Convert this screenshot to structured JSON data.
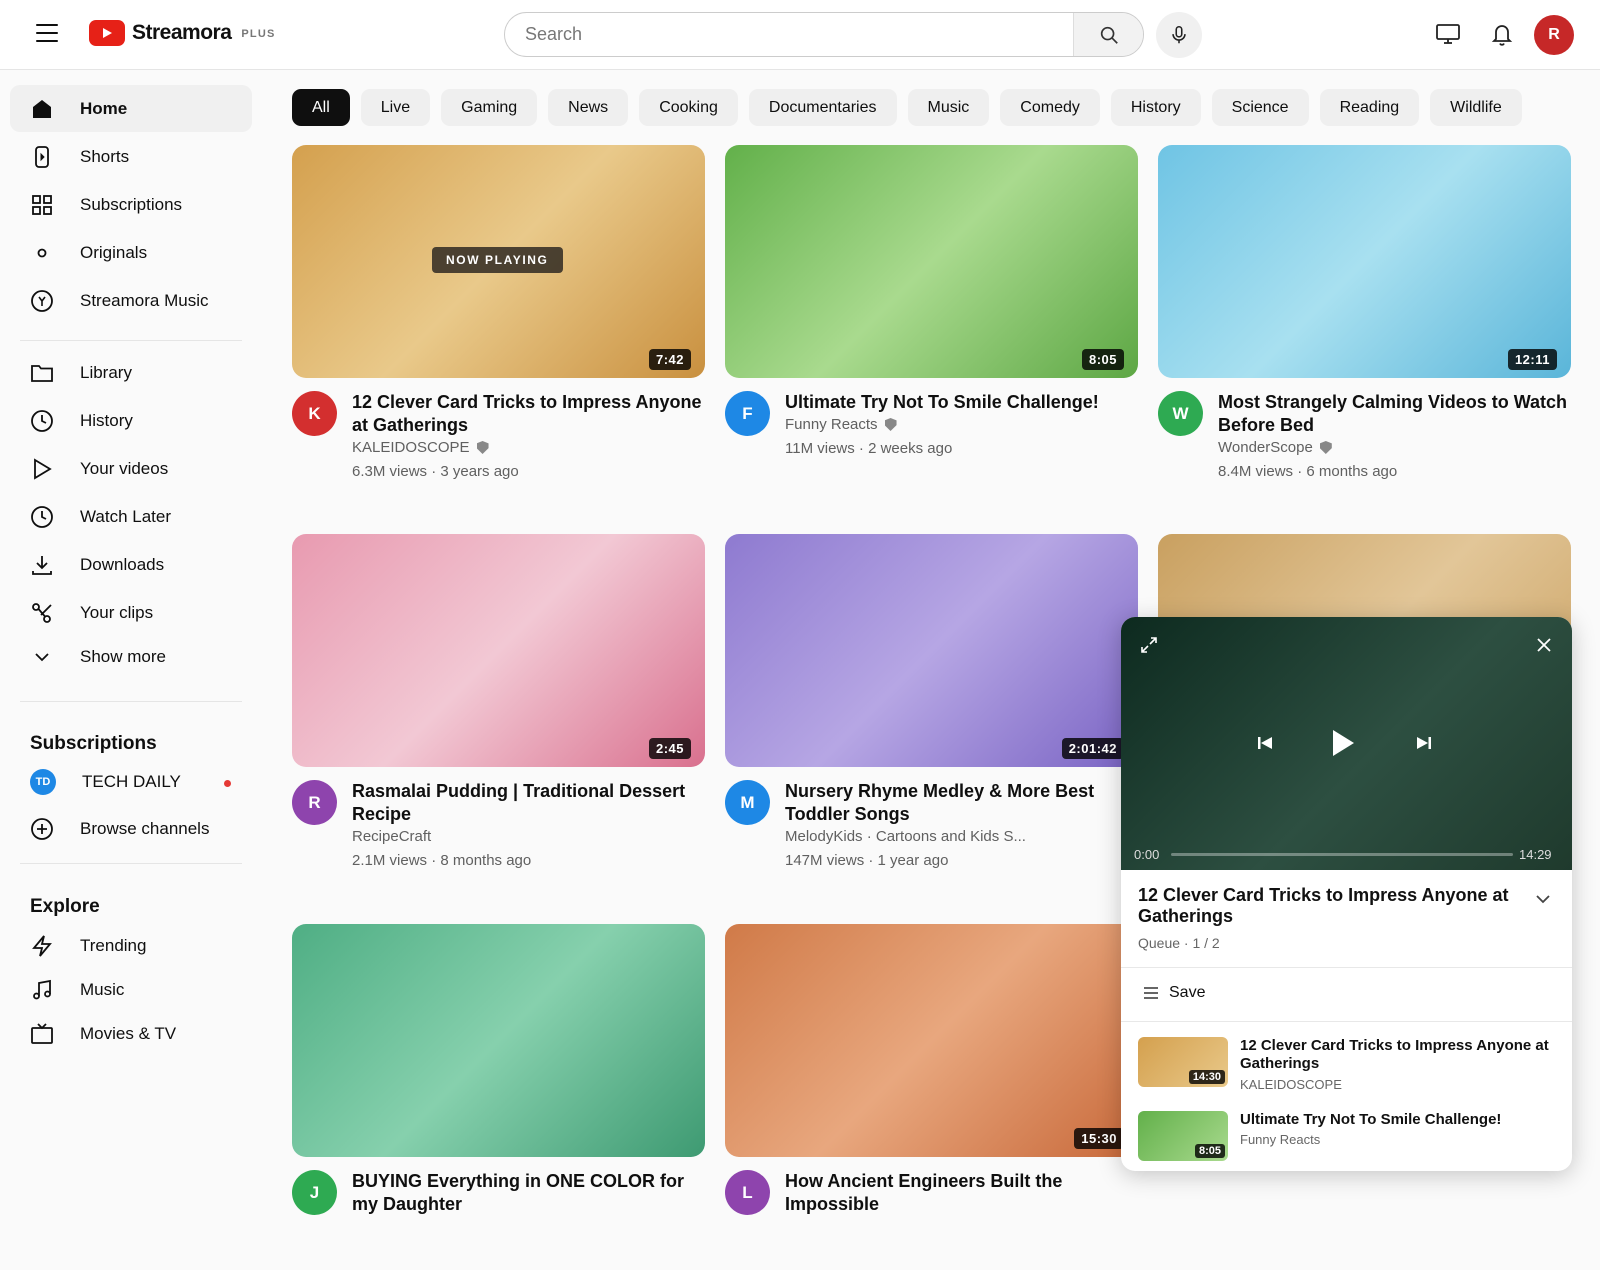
{
  "app": {
    "name": "Streamora",
    "badge": "PLUS"
  },
  "search": {
    "placeholder": "Search"
  },
  "user": {
    "initial": "R"
  },
  "sidebar": {
    "main": [
      {
        "label": "Home",
        "icon": "home-icon"
      },
      {
        "label": "Shorts",
        "icon": "shorts-icon"
      },
      {
        "label": "Subscriptions",
        "icon": "grid-icon"
      },
      {
        "label": "Originals",
        "icon": "circle-icon"
      },
      {
        "label": "Streamora Music",
        "icon": "music-circle-icon"
      }
    ],
    "library": [
      {
        "label": "Library",
        "icon": "folder-icon"
      },
      {
        "label": "History",
        "icon": "clock-icon"
      },
      {
        "label": "Your videos",
        "icon": "play-outline-icon"
      },
      {
        "label": "Watch Later",
        "icon": "clock-icon"
      },
      {
        "label": "Downloads",
        "icon": "download-icon"
      },
      {
        "label": "Your clips",
        "icon": "scissors-icon"
      },
      {
        "label": "Show more",
        "icon": "chevron-down-icon"
      }
    ],
    "subscriptions_heading": "Subscriptions",
    "subscriptions": [
      {
        "label": "TECH DAILY",
        "initials": "TD",
        "color": "#1e88e5",
        "new": true
      },
      {
        "label": "Browse channels",
        "icon": "plus-circle-icon"
      }
    ],
    "explore_heading": "Explore",
    "explore": [
      {
        "label": "Trending",
        "icon": "bolt-icon"
      },
      {
        "label": "Music",
        "icon": "music-note-icon"
      },
      {
        "label": "Movies & TV",
        "icon": "tv-icon"
      }
    ]
  },
  "chips": [
    "All",
    "Live",
    "Gaming",
    "News",
    "Cooking",
    "Documentaries",
    "Music",
    "Comedy",
    "History",
    "Science",
    "Reading",
    "Wildlife"
  ],
  "videos": [
    {
      "title": "12 Clever Card Tricks to Impress Anyone at Gatherings",
      "channel": "KALEIDOSCOPE",
      "verified": true,
      "views": "6.3M views · 3 years ago",
      "duration": "7:42",
      "overlay": "NOW PLAYING",
      "avatar": "K",
      "avatar_color": "#d32f2f",
      "colors": [
        "#d4a04e",
        "#e9c98a",
        "#c9903f"
      ]
    },
    {
      "title": "Ultimate Try Not To Smile Challenge!",
      "channel": "Funny Reacts",
      "verified": true,
      "views": "11M views · 2 weeks ago",
      "duration": "8:05",
      "avatar": "F",
      "avatar_color": "#1e88e5",
      "colors": [
        "#62b04a",
        "#a9da8e",
        "#5da744"
      ]
    },
    {
      "title": "Most Strangely Calming Videos to Watch Before Bed",
      "channel": "WonderScope",
      "verified": true,
      "views": "8.4M views · 6 months ago",
      "duration": "12:11",
      "avatar": "W",
      "avatar_color": "#2eaa52",
      "colors": [
        "#6fc4e4",
        "#a8e0f0",
        "#5ab5d9"
      ]
    },
    {
      "title": "Rasmalai Pudding | Traditional Dessert Recipe",
      "channel": "RecipeCraft",
      "verified": false,
      "views": "2.1M views · 8 months ago",
      "duration": "2:45",
      "avatar": "R",
      "avatar_color": "#8e44ad",
      "colors": [
        "#e89ab0",
        "#f2c8d4",
        "#d9708e"
      ]
    },
    {
      "title": "Nursery Rhyme Medley & More Best Toddler Songs",
      "channel": "MelodyKids · Cartoons and Kids S...",
      "verified": false,
      "views": "147M views · 1 year ago",
      "duration": "2:01:42",
      "avatar": "M",
      "avatar_color": "#1e88e5",
      "colors": [
        "#8e7ad0",
        "#b6a6e4",
        "#7a64c4"
      ]
    },
    {
      "title": "",
      "channel": "",
      "verified": false,
      "views": "",
      "duration": "",
      "avatar": "",
      "avatar_color": "#999",
      "colors": [
        "#c9a060",
        "#e2c698",
        "#c9a060"
      ]
    },
    {
      "title": "BUYING Everything in ONE COLOR for my Daughter",
      "channel": "",
      "verified": false,
      "views": "",
      "duration": "",
      "avatar": "J",
      "avatar_color": "#2eaa52",
      "colors": [
        "#4fae84",
        "#86d0ad",
        "#3e9a72"
      ]
    },
    {
      "title": "How Ancient Engineers Built the Impossible",
      "channel": "",
      "verified": false,
      "views": "",
      "duration": "15:30",
      "avatar": "L",
      "avatar_color": "#8e44ad",
      "colors": [
        "#d07a48",
        "#e8a77e",
        "#c8693a"
      ]
    }
  ],
  "miniplayer": {
    "current_time": "0:00",
    "total_time": "14:29",
    "progress": 0,
    "title": "12 Clever Card Tricks to Impress Anyone at Gatherings",
    "queue": "Queue · 1 / 2",
    "save_label": "Save",
    "queue_items": [
      {
        "title": "12 Clever Card Tricks to Impress Anyone at Gatherings",
        "channel": "KALEIDOSCOPE",
        "duration": "14:30",
        "colors": [
          "#d4a04e",
          "#e9c98a"
        ]
      },
      {
        "title": "Ultimate Try Not To Smile Challenge!",
        "channel": "Funny Reacts",
        "duration": "8:05",
        "colors": [
          "#62b04a",
          "#a9da8e"
        ]
      }
    ]
  }
}
